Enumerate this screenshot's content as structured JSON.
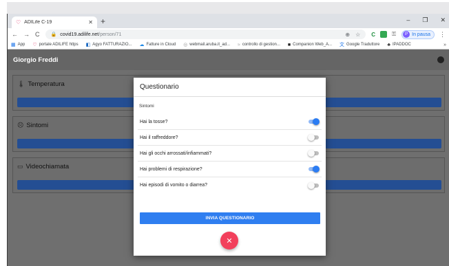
{
  "browser": {
    "tab_title": "ADILife C-19",
    "new_tab": "+",
    "win_minimize": "–",
    "win_restore": "❐",
    "win_close": "✕",
    "back": "←",
    "forward": "→",
    "reload": "C",
    "url_host": "covid19.adilife.net",
    "url_path": "/person/71",
    "profile_initial": "P",
    "profile_label": "In pausa",
    "menu": "⋮"
  },
  "bookmarks": {
    "items": [
      {
        "icon": "apps-icon",
        "label": "App"
      },
      {
        "icon": "heart-icon",
        "label": "portale ADILIFE https"
      },
      {
        "icon": "agyo-icon",
        "label": "Agyo FATTURAZIO..."
      },
      {
        "icon": "cloud-icon",
        "label": "Fatture in Cloud"
      },
      {
        "icon": "webmail-icon",
        "label": "webmail.aruba.it_ad..."
      },
      {
        "icon": "gestion-icon",
        "label": "controllo di gestion..."
      },
      {
        "icon": "companion-icon",
        "label": "Companion Web_A..."
      },
      {
        "icon": "translate-icon",
        "label": "Google Traduttore"
      },
      {
        "icon": "ipaddoc-icon",
        "label": "IPADDOC"
      }
    ],
    "more": "»"
  },
  "app": {
    "user_name": "Giorgio Freddi",
    "cards": [
      {
        "label": "Temperatura",
        "icon": "thermometer-icon"
      },
      {
        "label": "Sintomi",
        "icon": "symptoms-icon"
      },
      {
        "label": "Videochiamata",
        "icon": "video-icon"
      }
    ]
  },
  "dialog": {
    "title": "Questionario",
    "section": "Sintomi",
    "questions": [
      {
        "label": "Hai la tosse?",
        "on": true
      },
      {
        "label": "Hai il raffreddore?",
        "on": false
      },
      {
        "label": "Hai gli occhi arrossati/infiammati?",
        "on": false
      },
      {
        "label": "Hai problemi di respirazione?",
        "on": true
      },
      {
        "label": "Hai episodi di vomito o diarrea?",
        "on": false
      }
    ],
    "submit": "INVIA QUESTIONARIO",
    "close": "✕"
  },
  "colors": {
    "primary": "#2f7ef0",
    "fab": "#f2405c",
    "toggle_on": "#2b7cf3"
  }
}
